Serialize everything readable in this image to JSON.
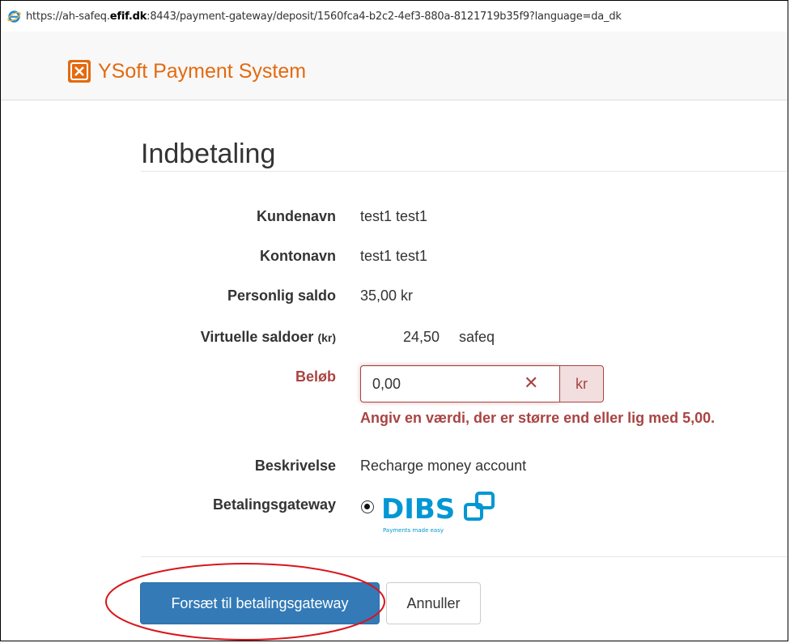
{
  "browser": {
    "url_prefix": "https://ah-safeq.",
    "url_domain": "efif.dk",
    "url_suffix": ":8443/payment-gateway/deposit/1560fca4-b2c2-4ef3-880a-8121719b35f9?language=da_dk",
    "icon": "internet-explorer-icon"
  },
  "brand": {
    "name": "YSoft Payment System",
    "icon": "safe-icon",
    "color": "#e36a0f"
  },
  "page": {
    "title": "Indbetaling"
  },
  "form": {
    "customer_label": "Kundenavn",
    "customer_value": "test1 test1",
    "account_label": "Kontonavn",
    "account_value": "test1 test1",
    "balance_label": "Personlig saldo",
    "balance_value": "35,00 kr",
    "virtual_label": "Virtuelle saldoer",
    "virtual_unit": "(kr)",
    "virtual_amount": "24,50",
    "virtual_name": "safeq",
    "amount_label": "Beløb",
    "amount_value": "0,00",
    "amount_addon": "kr",
    "amount_error": "Angiv en værdi, der er større end eller lig med 5,00.",
    "description_label": "Beskrivelse",
    "description_value": "Recharge money account",
    "gateway_label": "Betalingsgateway",
    "gateway_option": "DIBS",
    "gateway_tagline": "Payments made easy"
  },
  "buttons": {
    "continue": "Forsæt til betalingsgateway",
    "cancel": "Annuller"
  },
  "colors": {
    "error": "#a94442",
    "primary": "#337ab7",
    "dibs": "#0097d4",
    "annotation": "#d9151b"
  }
}
